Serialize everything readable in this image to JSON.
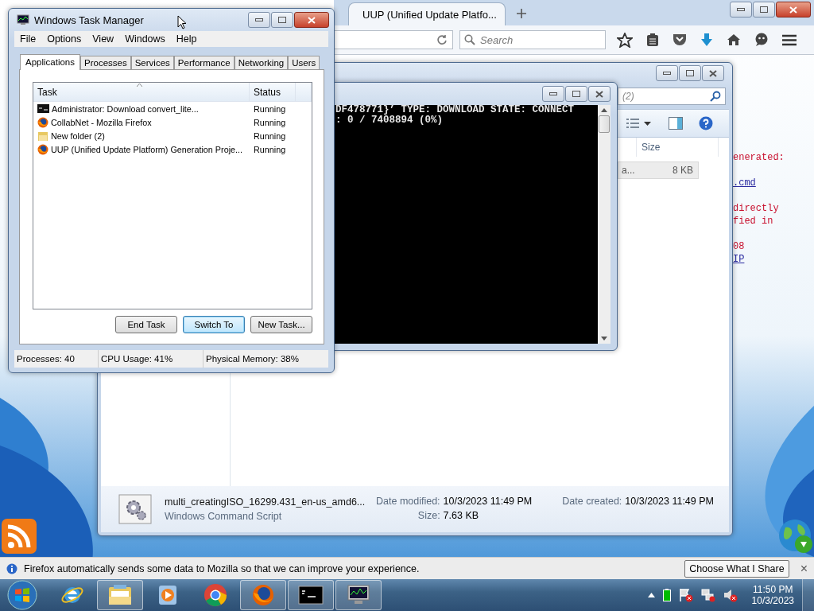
{
  "firefox": {
    "tab": {
      "title": "UUP (Unified Update Platfo...",
      "selected": true
    },
    "search": {
      "placeholder": "Search"
    },
    "page_paragraphs": [
      [
        {
          "text": "enerated:",
          "kind": "text"
        }
      ],
      [
        {
          "text": ".cmd",
          "kind": "link"
        }
      ],
      [
        {
          "text": "directly",
          "kind": "text"
        },
        {
          "text": "fied in",
          "kind": "text"
        }
      ],
      [
        {
          "text": "08",
          "kind": "text"
        },
        {
          "text": "IP",
          "kind": "link"
        }
      ]
    ],
    "notification": {
      "text": "Firefox automatically sends some data to Mozilla so that we can improve your experience.",
      "button": "Choose What I Share",
      "close": "×"
    }
  },
  "explorer": {
    "search": {
      "placeholder": "(2)"
    },
    "columns": [
      "Size"
    ],
    "rows": [
      {
        "name": "a...",
        "size": "8 KB",
        "selected": true
      }
    ],
    "details": {
      "file_name": "multi_creatingISO_16299.431_en-us_amd6...",
      "file_type": "Windows Command Script",
      "fields": [
        {
          "label": "Date modified:",
          "value": "10/3/2023 11:49 PM"
        },
        {
          "label": "Size:",
          "value": "7.63 KB"
        },
        {
          "label": "Date created:",
          "value": "10/3/2023 11:49 PM"
        }
      ]
    }
  },
  "console": {
    "lines": [
      "DF478771}’ TYPE: DOWNLOAD STATE: CONNECT",
      ": 0 / 7408894 (0%)"
    ]
  },
  "task_manager": {
    "title": "Windows Task Manager",
    "menu": [
      "File",
      "Options",
      "View",
      "Windows",
      "Help"
    ],
    "tabs": [
      {
        "label": "Applications",
        "selected": true
      },
      {
        "label": "Processes",
        "selected": false
      },
      {
        "label": "Services",
        "selected": false
      },
      {
        "label": "Performance",
        "selected": false
      },
      {
        "label": "Networking",
        "selected": false
      },
      {
        "label": "Users",
        "selected": false
      }
    ],
    "columns": [
      "Task",
      "Status"
    ],
    "rows": [
      {
        "kind": "console",
        "task": "Administrator:  Download convert_lite...",
        "status": "Running"
      },
      {
        "kind": "firefox",
        "task": "CollabNet - Mozilla Firefox",
        "status": "Running"
      },
      {
        "kind": "folder",
        "task": "New folder (2)",
        "status": "Running"
      },
      {
        "kind": "firefox",
        "task": "UUP (Unified Update Platform) Generation Proje...",
        "status": "Running"
      }
    ],
    "buttons": [
      {
        "label": "End Task",
        "default": false
      },
      {
        "label": "Switch To",
        "default": true
      },
      {
        "label": "New Task...",
        "default": false
      }
    ],
    "status_bar": [
      "Processes: 40",
      "CPU Usage: 41%",
      "Physical Memory: 38%"
    ]
  },
  "taskbar": {
    "apps": [
      {
        "kind": "ie",
        "open": false
      },
      {
        "kind": "explorer",
        "open": true
      },
      {
        "kind": "media-player",
        "open": false
      },
      {
        "kind": "chrome",
        "open": false
      },
      {
        "kind": "firefox",
        "open": true
      },
      {
        "kind": "console",
        "open": true
      },
      {
        "kind": "task-manager",
        "open": true
      }
    ],
    "clock": {
      "time": "11:50 PM",
      "date": "10/3/2023"
    }
  }
}
